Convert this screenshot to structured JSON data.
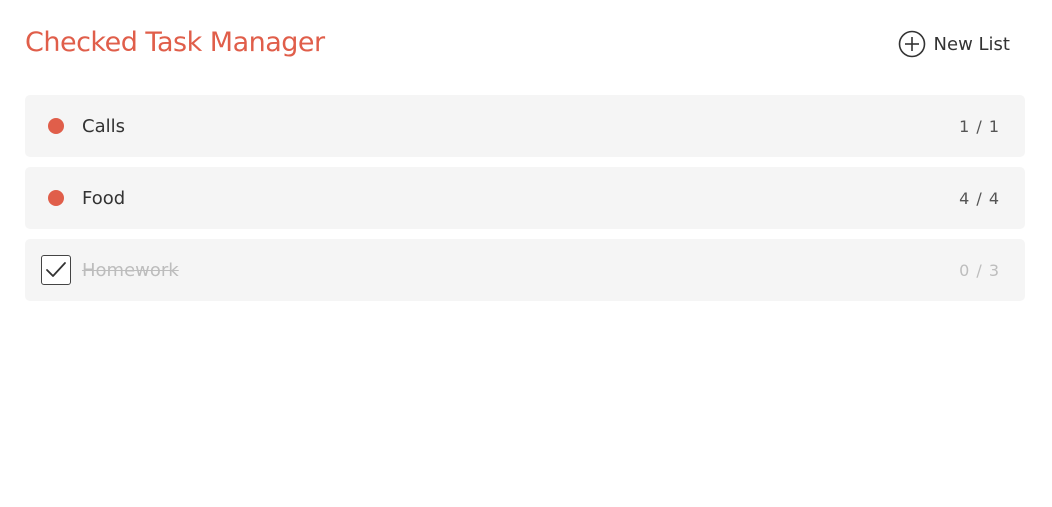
{
  "header": {
    "title": "Checked Task Manager",
    "new_list_label": "New List",
    "new_list_icon": "plus-circle-icon"
  },
  "colors": {
    "accent": "#e05e4a",
    "row_bg": "#f5f5f5",
    "done_text": "#bdbdbd"
  },
  "lists": [
    {
      "name": "Calls",
      "count": "1 / 1",
      "checked": false,
      "marker_icon": "red-dot-icon"
    },
    {
      "name": "Food",
      "count": "4 / 4",
      "checked": false,
      "marker_icon": "red-dot-icon"
    },
    {
      "name": "Homework",
      "count": "0 / 3",
      "checked": true,
      "marker_icon": "checkmark-icon"
    }
  ]
}
